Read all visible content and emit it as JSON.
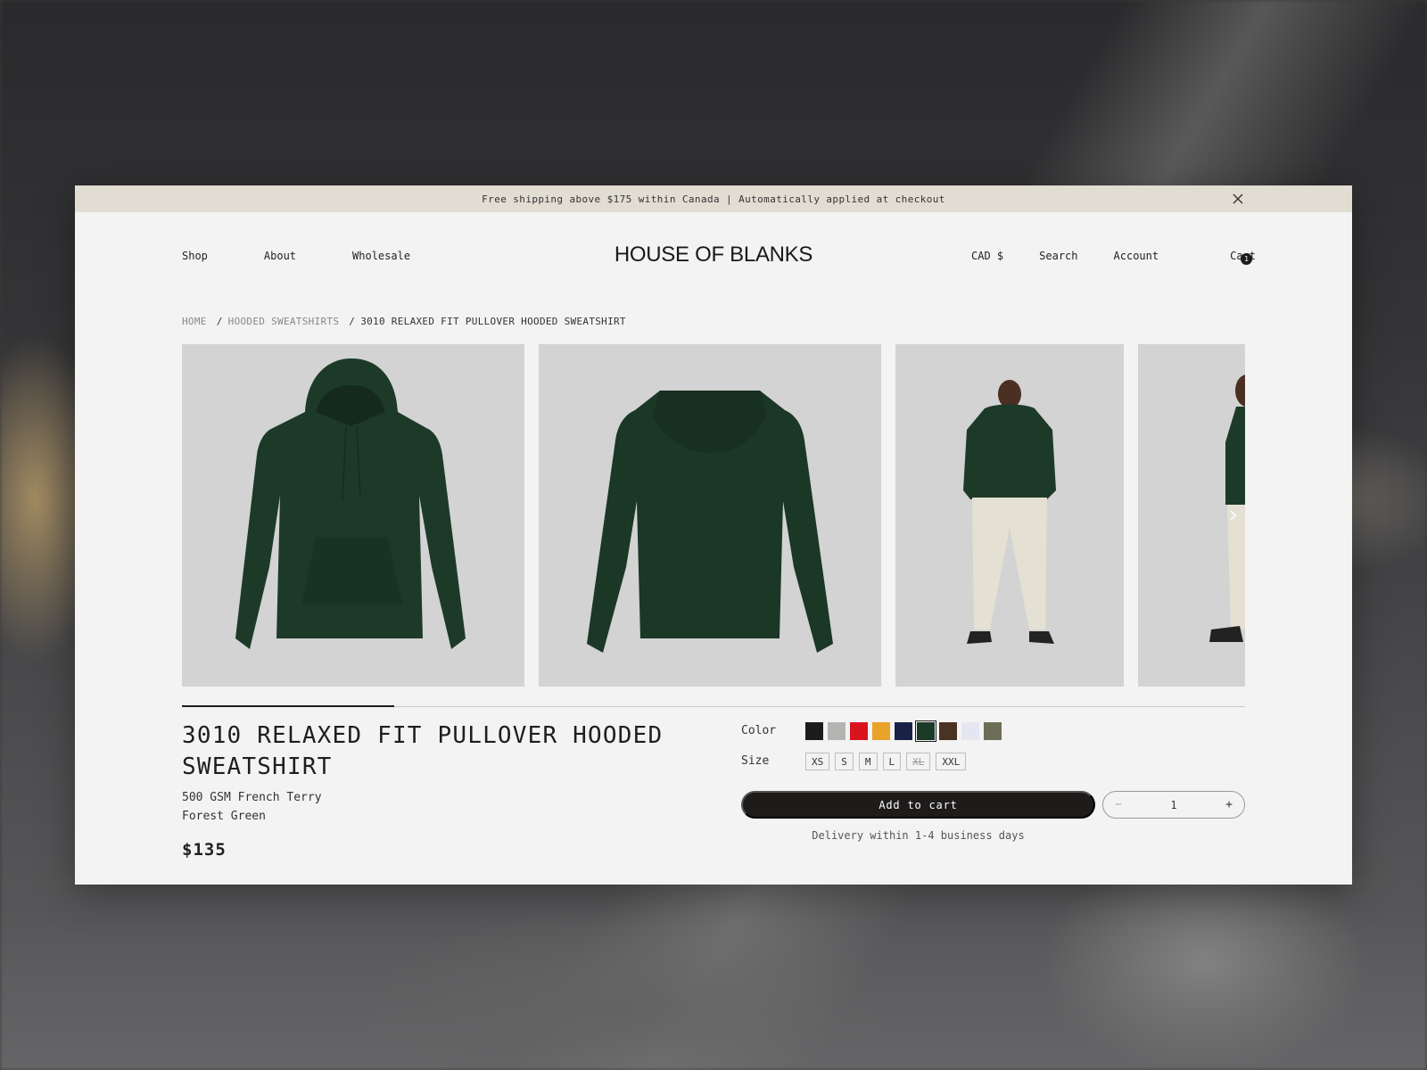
{
  "announcement": {
    "text": "Free shipping above $175 within Canada | Automatically applied at checkout"
  },
  "nav": {
    "left": [
      "Shop",
      "About",
      "Wholesale"
    ],
    "logo": "HOUSE OF BLANKS",
    "currency": "CAD $",
    "search": "Search",
    "account": "Account",
    "cart": "Cart",
    "cart_count": "1"
  },
  "breadcrumb": {
    "home": "HOME",
    "category": "HOODED SWEATSHIRTS",
    "current": "3010 RELAXED FIT PULLOVER HOODED SWEATSHIRT",
    "separator": "/"
  },
  "gallery": {
    "images": [
      "hoodie-front",
      "hoodie-back",
      "model-front",
      "model-side"
    ],
    "progress_fraction": 0.2
  },
  "product": {
    "title": "3010 RELAXED FIT PULLOVER HOODED SWEATSHIRT",
    "fabric": "500 GSM French Terry",
    "color_name": "Forest Green",
    "price": "$135"
  },
  "options": {
    "color_label": "Color",
    "size_label": "Size",
    "colors": [
      "#1c1c1c",
      "#b4b4b2",
      "#d9141e",
      "#e9a32a",
      "#1a2147",
      "#1b3a27",
      "#4a3322",
      "#e6e6f2",
      "#6e6e58"
    ],
    "selected_color_index": 5,
    "sizes": [
      {
        "label": "XS",
        "available": true
      },
      {
        "label": "S",
        "available": true
      },
      {
        "label": "M",
        "available": true
      },
      {
        "label": "L",
        "available": true
      },
      {
        "label": "XL",
        "available": false
      },
      {
        "label": "XXL",
        "available": true
      }
    ]
  },
  "purchase": {
    "add_to_cart": "Add to cart",
    "quantity": "1",
    "minus": "−",
    "plus": "+",
    "delivery": "Delivery within 1-4 business days"
  },
  "colors": {
    "announcement_bg": "#e2ddd3",
    "page_bg": "#f3f3f3",
    "button_bg": "#1e1b1b",
    "hoodie_green": "#1d3a29"
  }
}
